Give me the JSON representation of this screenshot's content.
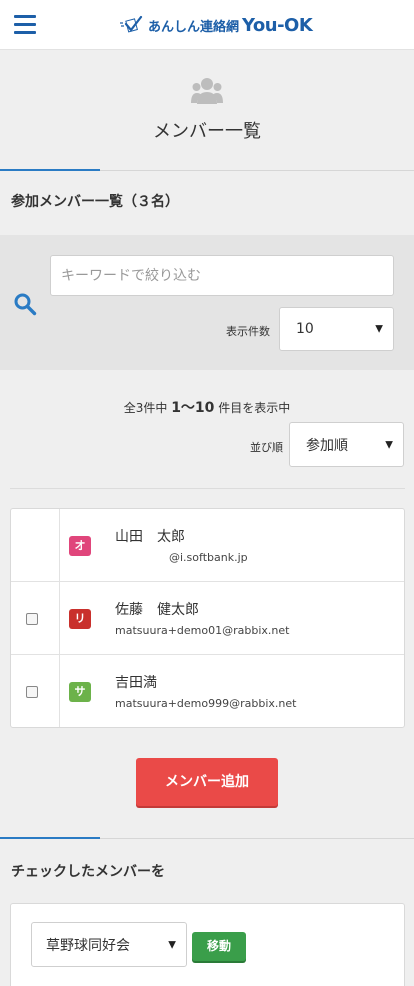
{
  "header": {
    "logo_text": "あんしん連絡網",
    "logo_brand": "You-OK"
  },
  "page": {
    "title": "メンバー一覧"
  },
  "members_section": {
    "heading": "参加メンバー一覧（３名）"
  },
  "filter": {
    "keyword_placeholder": "キーワードで絞り込む",
    "keyword_value": "",
    "perpage_label": "表示件数",
    "perpage_value": "10"
  },
  "result": {
    "count_prefix": "全3件中",
    "range": "1〜10",
    "count_suffix": "件目を表示中",
    "sort_label": "並び順",
    "sort_value": "参加順"
  },
  "members": [
    {
      "badge": "オ",
      "badge_color": "#e0457b",
      "name": "山田　太郎",
      "email": "@i.softbank.jp",
      "has_checkbox": false
    },
    {
      "badge": "リ",
      "badge_color": "#c9302c",
      "name": "佐藤　健太郎",
      "email": "matsuura+demo01@rabbix.net",
      "has_checkbox": true
    },
    {
      "badge": "サ",
      "badge_color": "#6cb24a",
      "name": "吉田満",
      "email": "matsuura+demo999@rabbix.net",
      "has_checkbox": true
    }
  ],
  "actions": {
    "add_member": "メンバー追加",
    "checked_heading": "チェックしたメンバーを",
    "group_select": "草野球同好会",
    "move_button": "移動"
  },
  "colors": {
    "brand_blue": "#1d5fa8",
    "accent_blue": "#2a7bc4",
    "add_red": "#ea4a48",
    "move_green": "#3a9e4a"
  }
}
